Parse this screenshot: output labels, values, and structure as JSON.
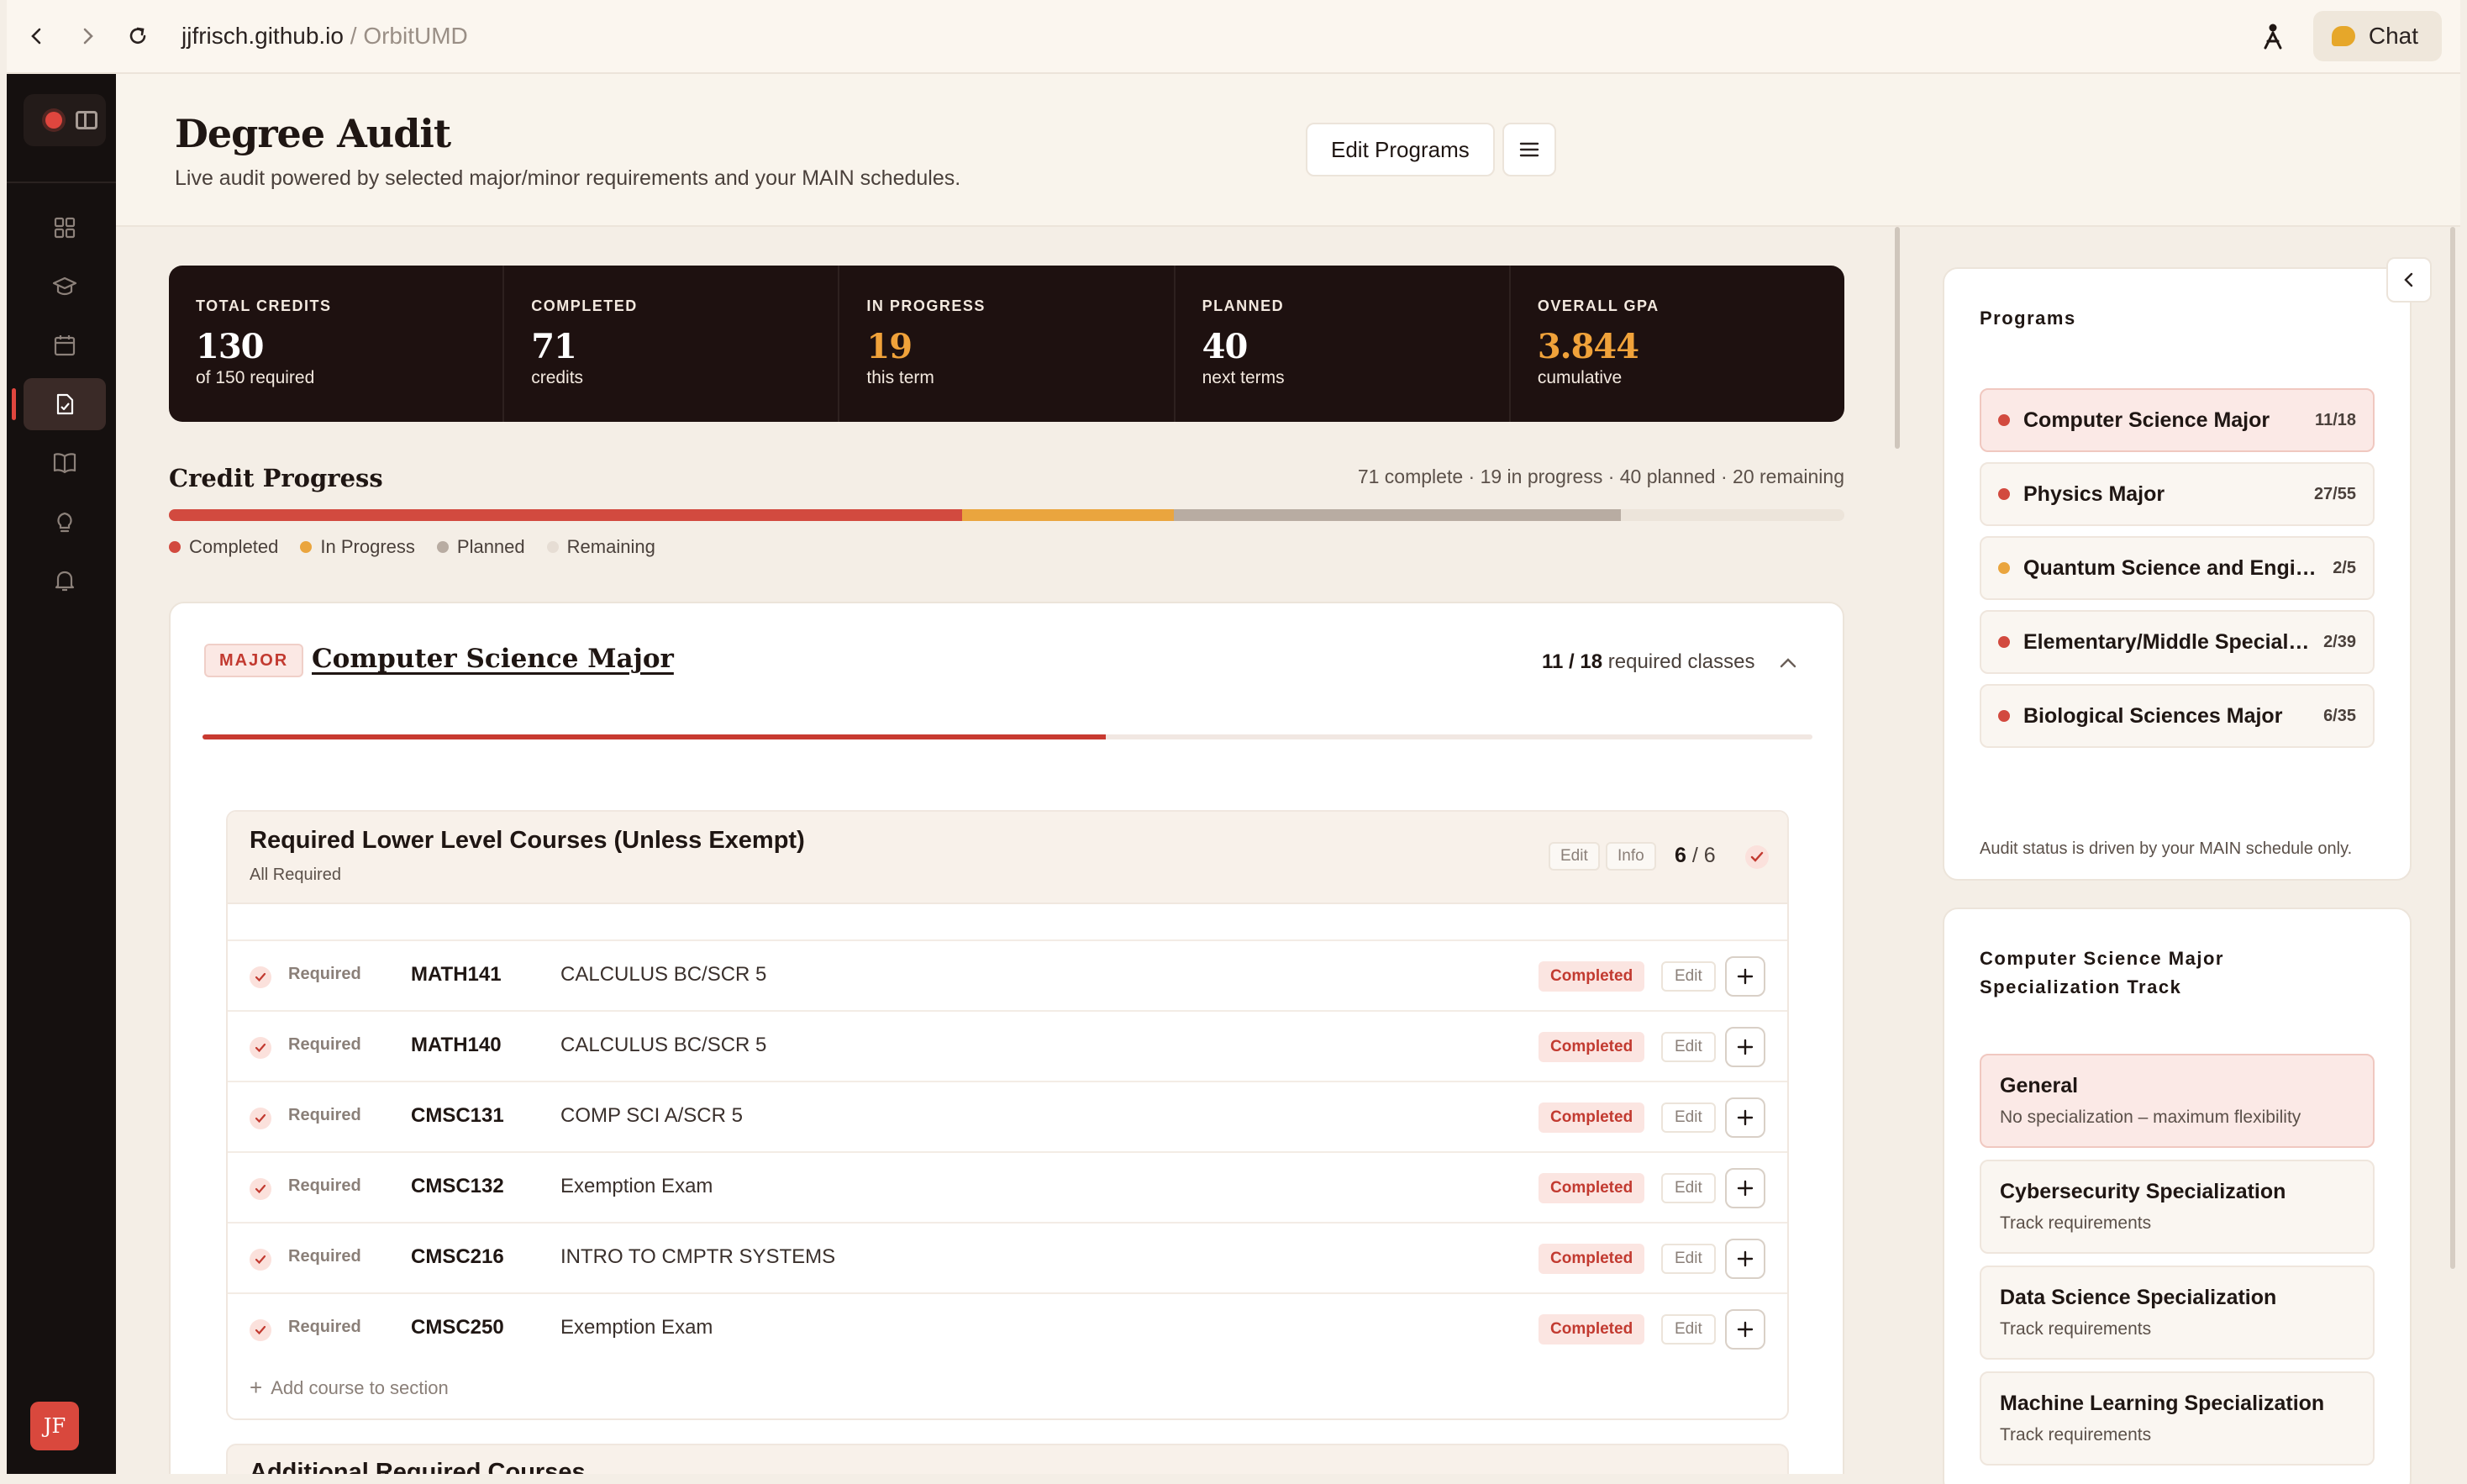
{
  "browser": {
    "domain": "jjfrisch.github.io",
    "separator": "/",
    "path": "OrbitUMD",
    "chat_label": "Chat"
  },
  "sidebar": {
    "items": [
      {
        "icon": "dashboard-icon",
        "active": false
      },
      {
        "icon": "graduation-cap-icon",
        "active": false
      },
      {
        "icon": "calendar-icon",
        "active": false
      },
      {
        "icon": "audit-doc-icon",
        "active": true
      },
      {
        "icon": "book-icon",
        "active": false
      },
      {
        "icon": "lightbulb-icon",
        "active": false
      },
      {
        "icon": "bell-icon",
        "active": false
      }
    ],
    "avatar_initials": "JF"
  },
  "header": {
    "title": "Degree Audit",
    "subtitle": "Live audit powered by selected major/minor requirements and your MAIN schedules.",
    "edit_programs_label": "Edit Programs"
  },
  "stats": [
    {
      "label": "TOTAL CREDITS",
      "value": "130",
      "sub": "of 150 required",
      "accent": false
    },
    {
      "label": "COMPLETED",
      "value": "71",
      "sub": "credits",
      "accent": false
    },
    {
      "label": "IN PROGRESS",
      "value": "19",
      "sub": "this term",
      "accent": true
    },
    {
      "label": "PLANNED",
      "value": "40",
      "sub": "next terms",
      "accent": false
    },
    {
      "label": "OVERALL GPA",
      "value": "3.844",
      "sub": "cumulative",
      "accent": true
    }
  ],
  "credit_progress": {
    "title": "Credit Progress",
    "summary": "71 complete · 19 in progress · 40 planned · 20 remaining",
    "completed": 71,
    "in_progress": 19,
    "planned": 40,
    "remaining": 20,
    "legend": [
      {
        "label": "Completed",
        "color": "#d24a3f"
      },
      {
        "label": "In Progress",
        "color": "#eaa53e"
      },
      {
        "label": "Planned",
        "color": "#b8aca2"
      },
      {
        "label": "Remaining",
        "color": "#e6ddd4"
      }
    ]
  },
  "major": {
    "badge": "MAJOR",
    "title": "Computer Science Major",
    "count_done": "11 / 18",
    "count_label": "required classes",
    "progress_fraction": 0.5611,
    "section": {
      "title": "Required Lower Level Courses (Unless Exempt)",
      "subtitle": "All Required",
      "edit_label": "Edit",
      "info_label": "Info",
      "count_done": "6",
      "count_total": "/ 6",
      "rows": [
        {
          "req": "Required",
          "code": "MATH141",
          "name": "CALCULUS BC/SCR 5",
          "status": "Completed",
          "edit": "Edit"
        },
        {
          "req": "Required",
          "code": "MATH140",
          "name": "CALCULUS BC/SCR 5",
          "status": "Completed",
          "edit": "Edit"
        },
        {
          "req": "Required",
          "code": "CMSC131",
          "name": "COMP SCI A/SCR 5",
          "status": "Completed",
          "edit": "Edit"
        },
        {
          "req": "Required",
          "code": "CMSC132",
          "name": "Exemption Exam",
          "status": "Completed",
          "edit": "Edit"
        },
        {
          "req": "Required",
          "code": "CMSC216",
          "name": "INTRO TO CMPTR SYSTEMS",
          "status": "Completed",
          "edit": "Edit"
        },
        {
          "req": "Required",
          "code": "CMSC250",
          "name": "Exemption Exam",
          "status": "Completed",
          "edit": "Edit"
        }
      ],
      "add_course_label": "Add course to section"
    },
    "next_section_title": "Additional Required Courses"
  },
  "programs_panel": {
    "title": "Programs",
    "items": [
      {
        "name": "Computer Science Major",
        "count": "11/18",
        "color": "#d24a3f",
        "active": true
      },
      {
        "name": "Physics Major",
        "count": "27/55",
        "color": "#d24a3f",
        "active": false
      },
      {
        "name": "Quantum Science and Engineering",
        "count": "2/5",
        "color": "#eaa53e",
        "active": false
      },
      {
        "name": "Elementary/Middle Special Education",
        "count": "2/39",
        "color": "#d24a3f",
        "active": false
      },
      {
        "name": "Biological Sciences Major",
        "count": "6/35",
        "color": "#d24a3f",
        "active": false
      }
    ],
    "note": "Audit status is driven by your MAIN schedule only."
  },
  "track_panel": {
    "title_line1": "Computer Science Major",
    "title_line2": "Specialization Track",
    "items": [
      {
        "name": "General",
        "desc": "No specialization – maximum flexibility",
        "active": true
      },
      {
        "name": "Cybersecurity Specialization",
        "desc": "Track requirements",
        "active": false
      },
      {
        "name": "Data Science Specialization",
        "desc": "Track requirements",
        "active": false
      },
      {
        "name": "Machine Learning Specialization",
        "desc": "Track requirements",
        "active": false
      }
    ]
  }
}
